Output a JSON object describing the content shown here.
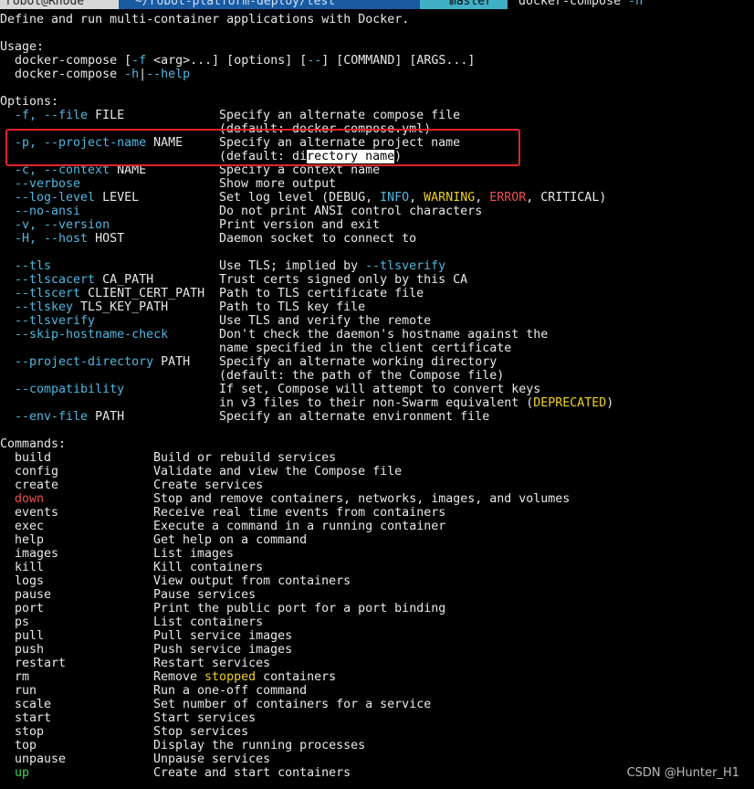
{
  "prompt": {
    "user": "robot@Rnode",
    "path": "~/robot-platform-deploy/test",
    "branch": "master",
    "branch_icon": "git-branch-icon",
    "command": "docker-compose",
    "flag": "-h"
  },
  "description": "Define and run multi-container applications with Docker.",
  "usage": {
    "heading": "Usage:",
    "line1": "  docker-compose [-f <arg>...] [options] [--] [COMMAND] [ARGS...]",
    "line2": "  docker-compose -h|--help"
  },
  "options_heading": "Options:",
  "commands_heading": "Commands:",
  "options": [
    {
      "flag": "-f, --file",
      "arg": " FILE",
      "desc": "Specify an alternate compose file"
    },
    {
      "flag": "",
      "arg": "",
      "desc": "(default: docker-compose.yml)"
    },
    {
      "flag": "-p, --project-name",
      "arg": " NAME",
      "desc": "Specify an alternate project name"
    },
    {
      "flag": "",
      "arg": "",
      "desc": "(default: directory name)"
    },
    {
      "flag": "-c, --context",
      "arg": " NAME",
      "desc": "Specify a context name"
    },
    {
      "flag": "--verbose",
      "arg": "",
      "desc": "Show more output"
    },
    {
      "flag": "--log-level",
      "arg": " LEVEL",
      "desc": "Set log level (DEBUG, INFO, WARNING, ERROR, CRITICAL)"
    },
    {
      "flag": "--no-ansi",
      "arg": "",
      "desc": "Do not print ANSI control characters"
    },
    {
      "flag": "-v, --version",
      "arg": "",
      "desc": "Print version and exit"
    },
    {
      "flag": "-H, --host",
      "arg": " HOST",
      "desc": "Daemon socket to connect to"
    },
    {
      "flag": "",
      "arg": "",
      "desc": ""
    },
    {
      "flag": "--tls",
      "arg": "",
      "desc": "Use TLS; implied by --tlsverify"
    },
    {
      "flag": "--tlscacert",
      "arg": " CA_PATH",
      "desc": "Trust certs signed only by this CA"
    },
    {
      "flag": "--tlscert",
      "arg": " CLIENT_CERT_PATH",
      "desc": "Path to TLS certificate file"
    },
    {
      "flag": "--tlskey",
      "arg": " TLS_KEY_PATH",
      "desc": "Path to TLS key file"
    },
    {
      "flag": "--tlsverify",
      "arg": "",
      "desc": "Use TLS and verify the remote"
    },
    {
      "flag": "--skip-hostname-check",
      "arg": "",
      "desc": "Don't check the daemon's hostname against the"
    },
    {
      "flag": "",
      "arg": "",
      "desc": "name specified in the client certificate"
    },
    {
      "flag": "--project-directory",
      "arg": " PATH",
      "desc": "Specify an alternate working directory"
    },
    {
      "flag": "",
      "arg": "",
      "desc": "(default: the path of the Compose file)"
    },
    {
      "flag": "--compatibility",
      "arg": "",
      "desc": "If set, Compose will attempt to convert keys"
    },
    {
      "flag": "",
      "arg": "",
      "desc": "in v3 files to their non-Swarm equivalent (DEPRECATED)"
    },
    {
      "flag": "--env-file",
      "arg": " PATH",
      "desc": "Specify an alternate environment file"
    }
  ],
  "commands": [
    {
      "name": "build",
      "desc": "Build or rebuild services"
    },
    {
      "name": "config",
      "desc": "Validate and view the Compose file"
    },
    {
      "name": "create",
      "desc": "Create services"
    },
    {
      "name": "down",
      "desc": "Stop and remove containers, networks, images, and volumes"
    },
    {
      "name": "events",
      "desc": "Receive real time events from containers"
    },
    {
      "name": "exec",
      "desc": "Execute a command in a running container"
    },
    {
      "name": "help",
      "desc": "Get help on a command"
    },
    {
      "name": "images",
      "desc": "List images"
    },
    {
      "name": "kill",
      "desc": "Kill containers"
    },
    {
      "name": "logs",
      "desc": "View output from containers"
    },
    {
      "name": "pause",
      "desc": "Pause services"
    },
    {
      "name": "port",
      "desc": "Print the public port for a port binding"
    },
    {
      "name": "ps",
      "desc": "List containers"
    },
    {
      "name": "pull",
      "desc": "Pull service images"
    },
    {
      "name": "push",
      "desc": "Push service images"
    },
    {
      "name": "restart",
      "desc": "Restart services"
    },
    {
      "name": "rm",
      "desc": "Remove stopped containers"
    },
    {
      "name": "run",
      "desc": "Run a one-off command"
    },
    {
      "name": "scale",
      "desc": "Set number of containers for a service"
    },
    {
      "name": "start",
      "desc": "Start services"
    },
    {
      "name": "stop",
      "desc": "Stop services"
    },
    {
      "name": "top",
      "desc": "Display the running processes"
    },
    {
      "name": "unpause",
      "desc": "Unpause services"
    },
    {
      "name": "up",
      "desc": "Create and start containers"
    }
  ],
  "watermark": "CSDN @Hunter_H1",
  "colors": {
    "background": "#000000",
    "text": "#e8e8e8",
    "flag": "#4fb8e0",
    "warning": "#f0d020",
    "error": "#f05050",
    "up": "#3ecf5a",
    "annotation_box": "#e0242a"
  }
}
